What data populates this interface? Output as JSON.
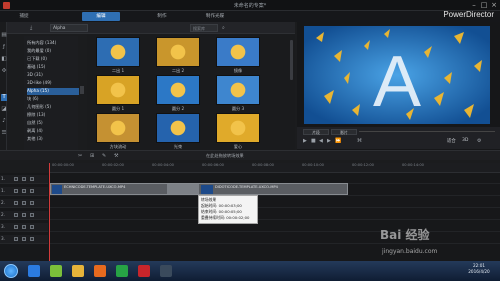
{
  "window": {
    "title": "未命名的专案*",
    "brand": "PowerDirector"
  },
  "menu": {
    "tabs": [
      "捕捉",
      "编辑",
      "制作",
      "制作光碟"
    ],
    "active": 1
  },
  "library": {
    "filter_value": "Alpha",
    "search_placeholder": "搜索库",
    "categories": [
      {
        "label": "所有内容 (134)"
      },
      {
        "label": "我的最爱 (0)"
      },
      {
        "label": "已下载 (0)"
      },
      {
        "label": "基础 (15)"
      },
      {
        "label": "3D (31)"
      },
      {
        "label": "3D-like (49)"
      },
      {
        "label": "Alpha (15)",
        "selected": true
      },
      {
        "label": "块 (6)"
      },
      {
        "label": "几何图形 (5)"
      },
      {
        "label": "擦除 (13)"
      },
      {
        "label": "自然 (5)"
      },
      {
        "label": "剥离 (4)"
      },
      {
        "label": "其他 (3)"
      }
    ],
    "tiles": [
      {
        "label": "二出 1",
        "color": "#2d6db3"
      },
      {
        "label": "二出 2",
        "color": "#c9962c"
      },
      {
        "label": "镜像",
        "color": "#3a7bc8"
      },
      {
        "label": "圆分 1",
        "color": "#d8a325"
      },
      {
        "label": "圆分 2",
        "color": "#2c78c6"
      },
      {
        "label": "圆分 3",
        "color": "#3e86cf"
      },
      {
        "label": "方块流动",
        "color": "#c59132"
      },
      {
        "label": "光束",
        "color": "#2563ad"
      },
      {
        "label": "爱心",
        "color": "#e0aa2a"
      }
    ]
  },
  "preview": {
    "letter": "A",
    "bg": "#1a5fa8",
    "mode_clip": "片段",
    "mode_movie": "影片",
    "fit": "适合",
    "threed": "3D"
  },
  "timeline": {
    "hint": "在此处拖放转场效果",
    "ruler": [
      "00:00:00:00",
      "00:00:02:00",
      "00:00:04:00",
      "00:00:06:00",
      "00:00:08:00",
      "00:00:10:00",
      "00:00:12:00",
      "00:00:14:00"
    ],
    "tracks": [
      "1.",
      "1.",
      "2.",
      "2.",
      "3.",
      "3."
    ],
    "clip_label_a": "ECHNICODE-TEMPLATE-UXCO-MP4",
    "clip_label_b": "DIDOTICODE-TEMPLATE-UXCO-MP4",
    "tooltip": {
      "title": "转场效果",
      "start": "起始时间: 00:00:03;00",
      "end": "结束时间: 00:00:05;00",
      "duration": "重叠持续时间: 00:00:02;00"
    }
  },
  "taskbar": {
    "time": "22:01",
    "date": "2016/4/20",
    "icons": [
      {
        "name": "globe-icon",
        "color": "#2b7be0"
      },
      {
        "name": "paint-icon",
        "color": "#7bbf3a"
      },
      {
        "name": "folder-icon",
        "color": "#e5b33a"
      },
      {
        "name": "firefox-icon",
        "color": "#e66a1f"
      },
      {
        "name": "media-icon",
        "color": "#27a345"
      },
      {
        "name": "record-icon",
        "color": "#c7252b"
      },
      {
        "name": "powerdirector-icon",
        "color": "#3a4a5c"
      }
    ]
  },
  "watermark": {
    "text": "Bai 经验",
    "url": "jingyan.baidu.com"
  }
}
